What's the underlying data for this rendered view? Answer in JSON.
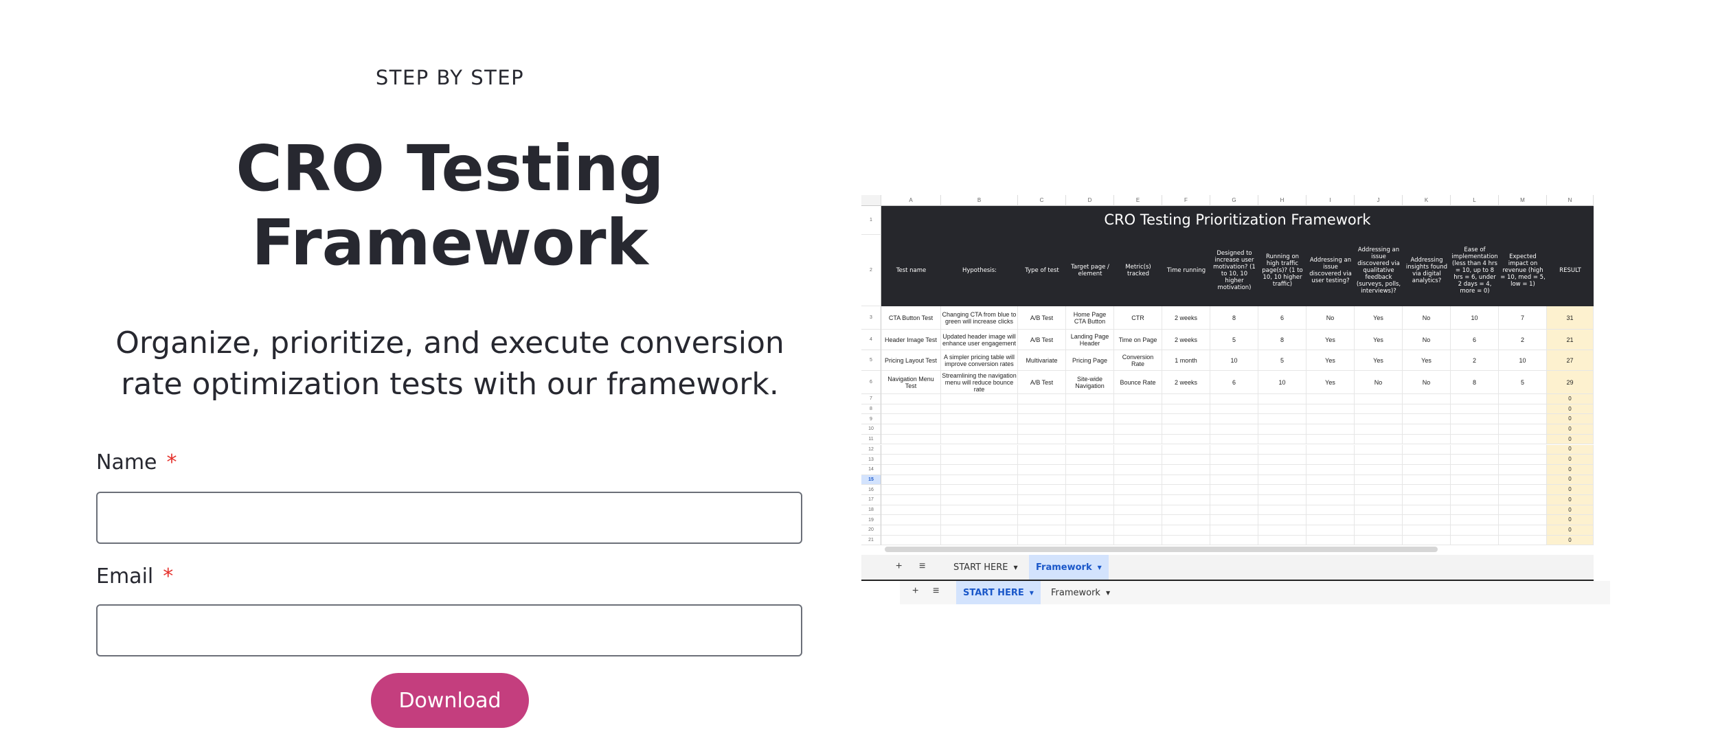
{
  "hero": {
    "eyebrow": "STEP BY STEP",
    "title_line1": "CRO Testing",
    "title_line2": "Framework",
    "subtitle_line1": "Organize, prioritize, and execute conversion",
    "subtitle_line2": "rate optimization tests with our framework."
  },
  "form": {
    "name_label": "Name",
    "email_label": "Email",
    "required_mark": "*",
    "name_value": "",
    "email_value": "",
    "submit_label": "Download",
    "accent_color": "#c43e7e"
  },
  "spreadsheet": {
    "title": "CRO Testing Prioritization Framework",
    "columns": [
      "A",
      "B",
      "C",
      "D",
      "E",
      "F",
      "G",
      "H",
      "I",
      "J",
      "K",
      "L",
      "M",
      "N"
    ],
    "headers": [
      "Test name",
      "Hypothesis:",
      "Type of test",
      "Target page / element",
      "Metric(s) tracked",
      "Time running",
      "Designed to increase user motivation? (1 to 10, 10 higher motivation)",
      "Running on high traffic page(s)? (1 to 10, 10 higher traffic)",
      "Addressing an issue discovered via user testing?",
      "Addressing an issue discovered via qualitative feedback (surveys, polls, interviews)?",
      "Addressing insights found via digital analytics?",
      "Ease of implementation (less than 4 hrs = 10, up to 8 hrs = 6, under 2 days = 4, more = 0)",
      "Expected impact on revenue (high = 10, med = 5, low = 1)",
      "RESULT"
    ],
    "rows": [
      [
        "CTA Button Test",
        "Changing CTA from blue to green will increase clicks",
        "A/B Test",
        "Home Page CTA Button",
        "CTR",
        "2 weeks",
        "8",
        "6",
        "No",
        "Yes",
        "No",
        "10",
        "7",
        "31"
      ],
      [
        "Header Image Test",
        "Updated header image will enhance user engagement",
        "A/B Test",
        "Landing Page Header",
        "Time on Page",
        "2 weeks",
        "5",
        "8",
        "Yes",
        "Yes",
        "No",
        "6",
        "2",
        "21"
      ],
      [
        "Pricing Layout Test",
        "A simpler pricing table will improve conversion rates",
        "Multivariate",
        "Pricing Page",
        "Conversion Rate",
        "1 month",
        "10",
        "5",
        "Yes",
        "Yes",
        "Yes",
        "2",
        "10",
        "27"
      ],
      [
        "Navigation Menu Test",
        "Streamlining the navigation menu will reduce bounce rate",
        "A/B Test",
        "Site-wide Navigation",
        "Bounce Rate",
        "2 weeks",
        "6",
        "10",
        "Yes",
        "No",
        "No",
        "8",
        "5",
        "29"
      ]
    ],
    "row_numbers": [
      "1",
      "2",
      "3",
      "4",
      "5",
      "6",
      "7",
      "8",
      "9",
      "10",
      "11",
      "12",
      "13",
      "14",
      "15",
      "16",
      "17",
      "18",
      "19",
      "20",
      "21"
    ],
    "selected_row": "15",
    "empty_result_value": "0",
    "tabs_front": [
      {
        "label": "START HERE",
        "active": false
      },
      {
        "label": "Framework",
        "active": true
      }
    ],
    "tabs_back": [
      {
        "label": "START HERE",
        "active": true
      },
      {
        "label": "Framework",
        "active": false
      }
    ],
    "add_sheet_icon": "+",
    "all_sheets_icon": "≡",
    "result_fill_color": "#fdf1cf",
    "header_fill_color": "#26272c"
  }
}
